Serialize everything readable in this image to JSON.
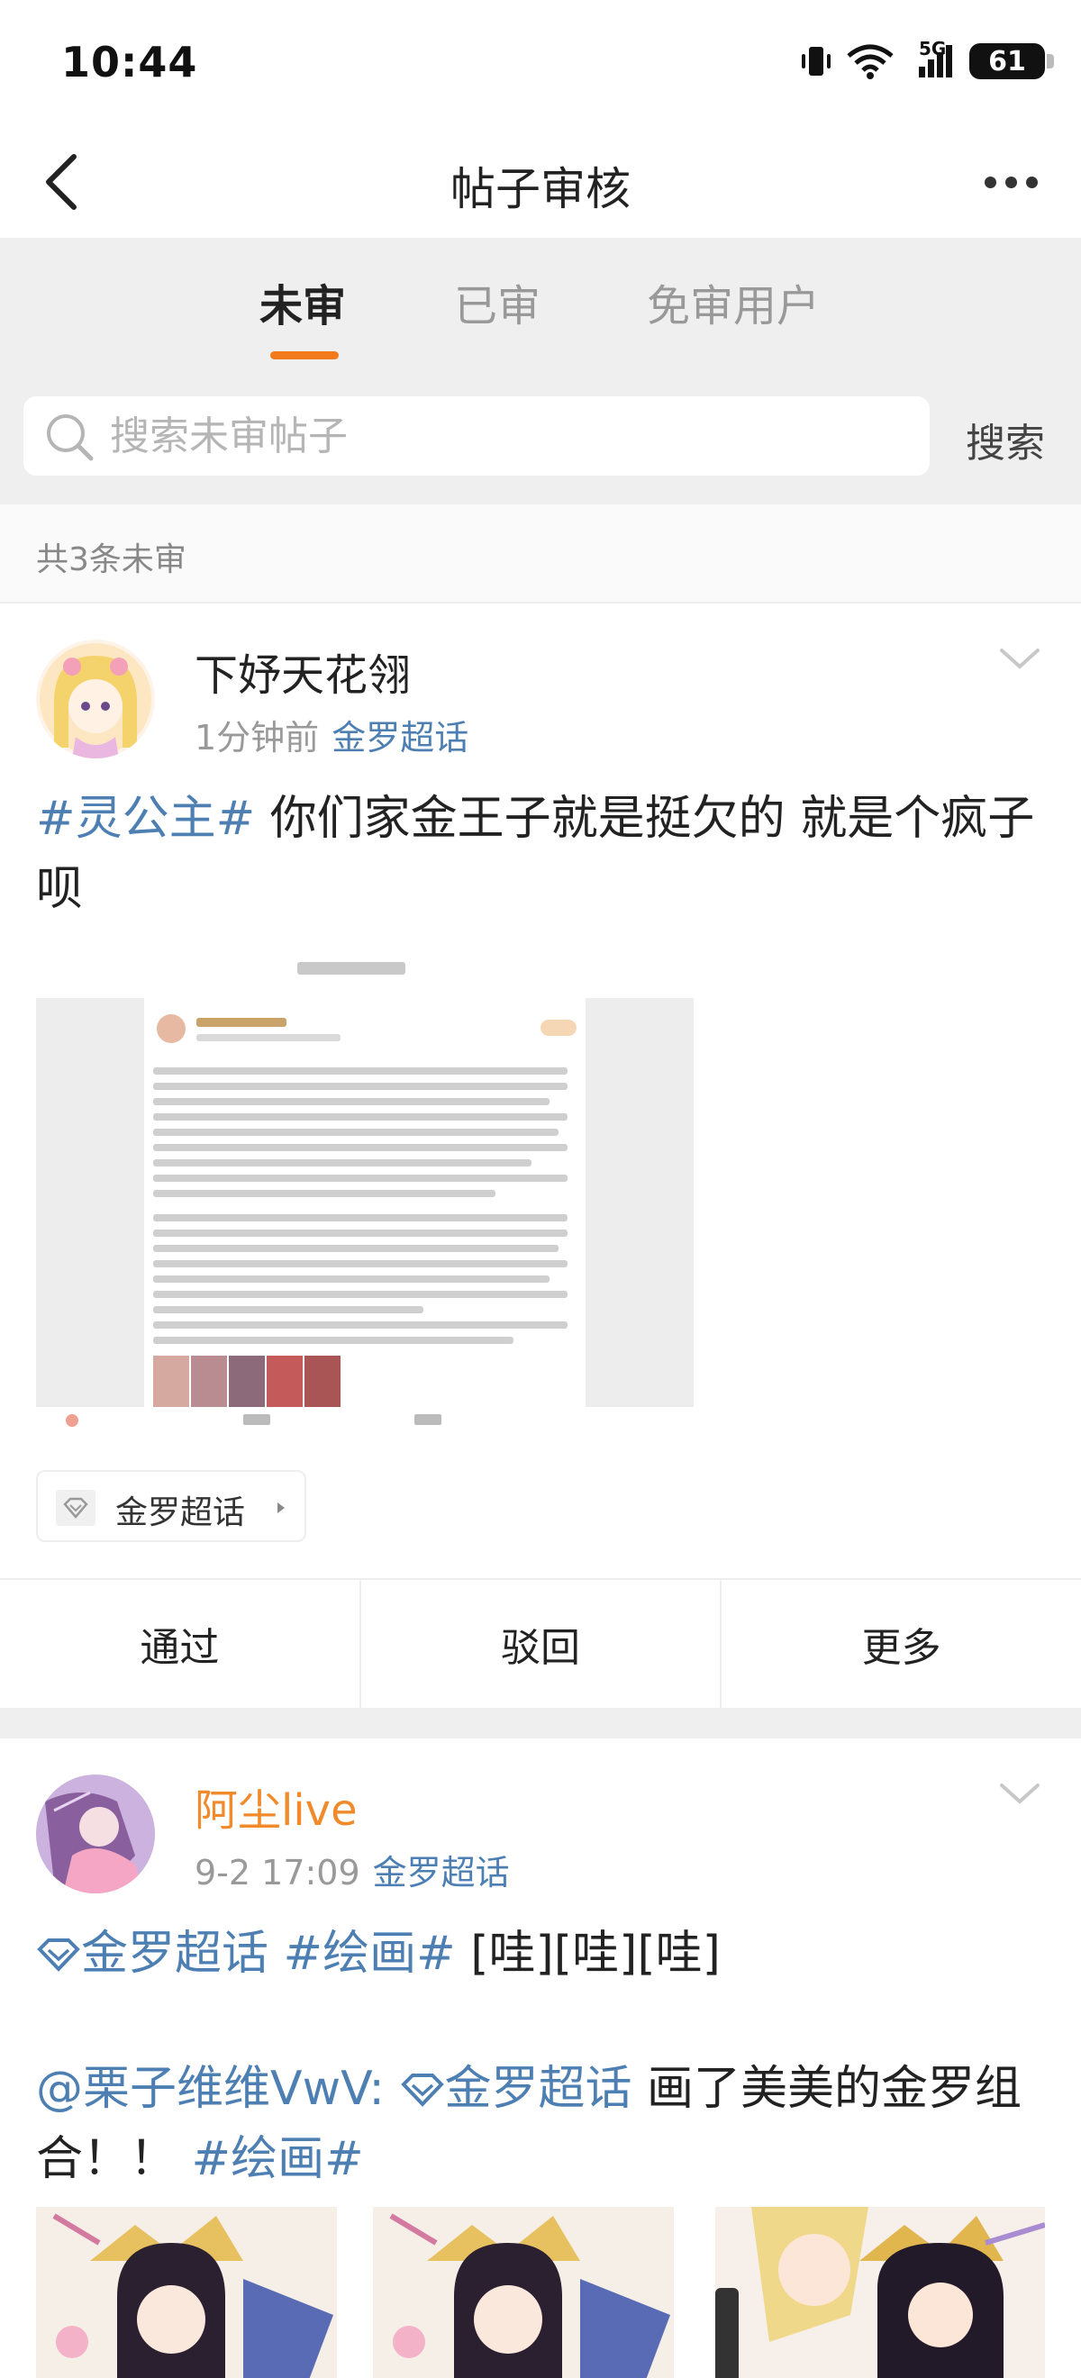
{
  "status_bar": {
    "time": "10:44",
    "network": "5G",
    "battery": "61"
  },
  "nav": {
    "title": "帖子审核",
    "back_icon": "chevron-left-icon",
    "more_icon": "more-dots-icon"
  },
  "tabs": [
    {
      "label": "未审",
      "active": true
    },
    {
      "label": "已审",
      "active": false
    },
    {
      "label": "免审用户",
      "active": false
    }
  ],
  "accent_color": "#f27a1a",
  "link_color": "#4d7fb3",
  "search": {
    "placeholder": "搜索未审帖子",
    "value": "",
    "button_label": "搜索"
  },
  "count_text": "共3条未审",
  "posts": [
    {
      "username": "下妤天花翎",
      "time": "1分钟前",
      "topic": "金罗超话",
      "hashtag": "#灵公主#",
      "text": " 你们家金王子就是挺欠的 就是个疯子呗",
      "topic_chip": "金罗超话",
      "actions": [
        "通过",
        "驳回",
        "更多"
      ]
    },
    {
      "username": "阿尘live",
      "time": "9-2 17:09",
      "topic": "金罗超话",
      "line1_topic": "金罗超话",
      "line1_hashtag": "#绘画#",
      "line1_text": "[哇][哇][哇]",
      "line2_mention": "@栗子维维VwV:",
      "line2_topic": "金罗超话",
      "line2_text": " 画了美美的金罗组合！！",
      "line2_hashtag": "#绘画#"
    }
  ]
}
